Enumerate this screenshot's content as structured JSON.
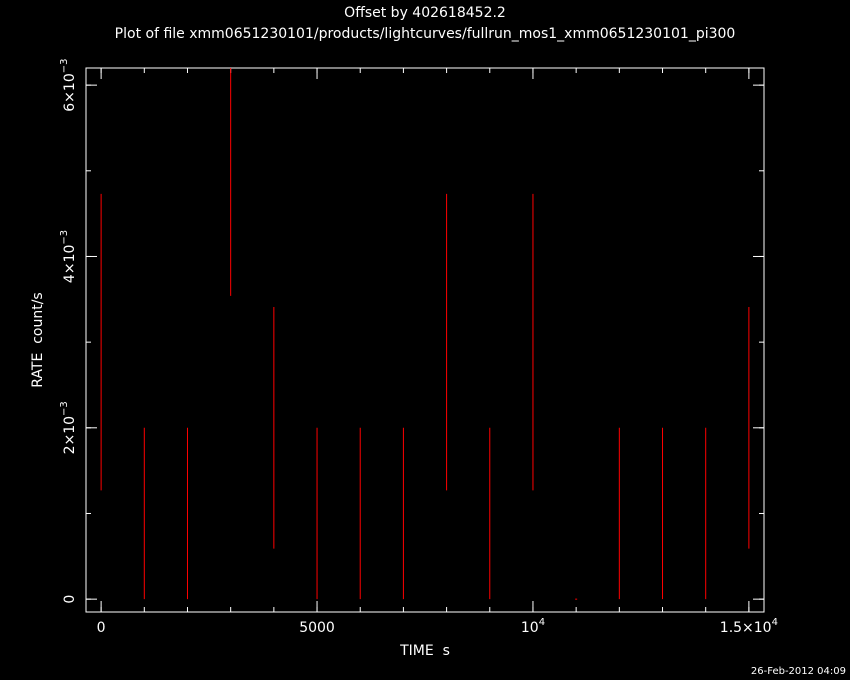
{
  "header": {
    "title": "Offset by 402618452.2",
    "subtitle": "Plot of file xmm0651230101/products/lightcurves/fullrun_mos1_xmm0651230101_pi300"
  },
  "footer": {
    "timestamp": "26-Feb-2012 04:09"
  },
  "colors": {
    "background": "#000000",
    "axes": "#ffffff",
    "data": "#ff0000"
  },
  "chart_data": {
    "type": "scatter",
    "style": "error-bars",
    "title": "Offset by 402618452.2",
    "subtitle": "Plot of file xmm0651230101/products/lightcurves/fullrun_mos1_xmm0651230101_pi300",
    "xlabel": "TIME  s",
    "ylabel": "RATE  count/s",
    "xlim": [
      -350,
      15350
    ],
    "ylim": [
      -0.00015,
      0.0062
    ],
    "x_ticks": [
      {
        "value": 0,
        "label": "0"
      },
      {
        "value": 5000,
        "label": "5000"
      },
      {
        "value": 10000,
        "label": "10",
        "exp": "4"
      },
      {
        "value": 15000,
        "label": "1.5×10",
        "exp": "4"
      }
    ],
    "x_minor_step": 1000,
    "y_ticks": [
      {
        "value": 0,
        "label": "0"
      },
      {
        "value": 0.002,
        "label": "2×10",
        "exp": "−3"
      },
      {
        "value": 0.004,
        "label": "4×10",
        "exp": "−3"
      },
      {
        "value": 0.006,
        "label": "6×10",
        "exp": "−3"
      }
    ],
    "y_minor_step": 0.001,
    "grid": false,
    "series": [
      {
        "points": [
          {
            "x": 0,
            "y": 0.003,
            "err": 0.00173
          },
          {
            "x": 1000,
            "y": 0.001,
            "err": 0.001
          },
          {
            "x": 2000,
            "y": 0.001,
            "err": 0.001
          },
          {
            "x": 3000,
            "y": 0.0058,
            "err": 0.00226
          },
          {
            "x": 4000,
            "y": 0.002,
            "err": 0.00141
          },
          {
            "x": 5000,
            "y": 0.001,
            "err": 0.001
          },
          {
            "x": 6000,
            "y": 0.001,
            "err": 0.001
          },
          {
            "x": 7000,
            "y": 0.001,
            "err": 0.001
          },
          {
            "x": 8000,
            "y": 0.003,
            "err": 0.00173
          },
          {
            "x": 9000,
            "y": 0.001,
            "err": 0.001
          },
          {
            "x": 10000,
            "y": 0.003,
            "err": 0.00173
          },
          {
            "x": 11000,
            "y": 0,
            "err": 0
          },
          {
            "x": 12000,
            "y": 0.001,
            "err": 0.001
          },
          {
            "x": 13000,
            "y": 0.001,
            "err": 0.001
          },
          {
            "x": 14000,
            "y": 0.001,
            "err": 0.001
          },
          {
            "x": 15000,
            "y": 0.002,
            "err": 0.00141
          }
        ]
      }
    ]
  }
}
